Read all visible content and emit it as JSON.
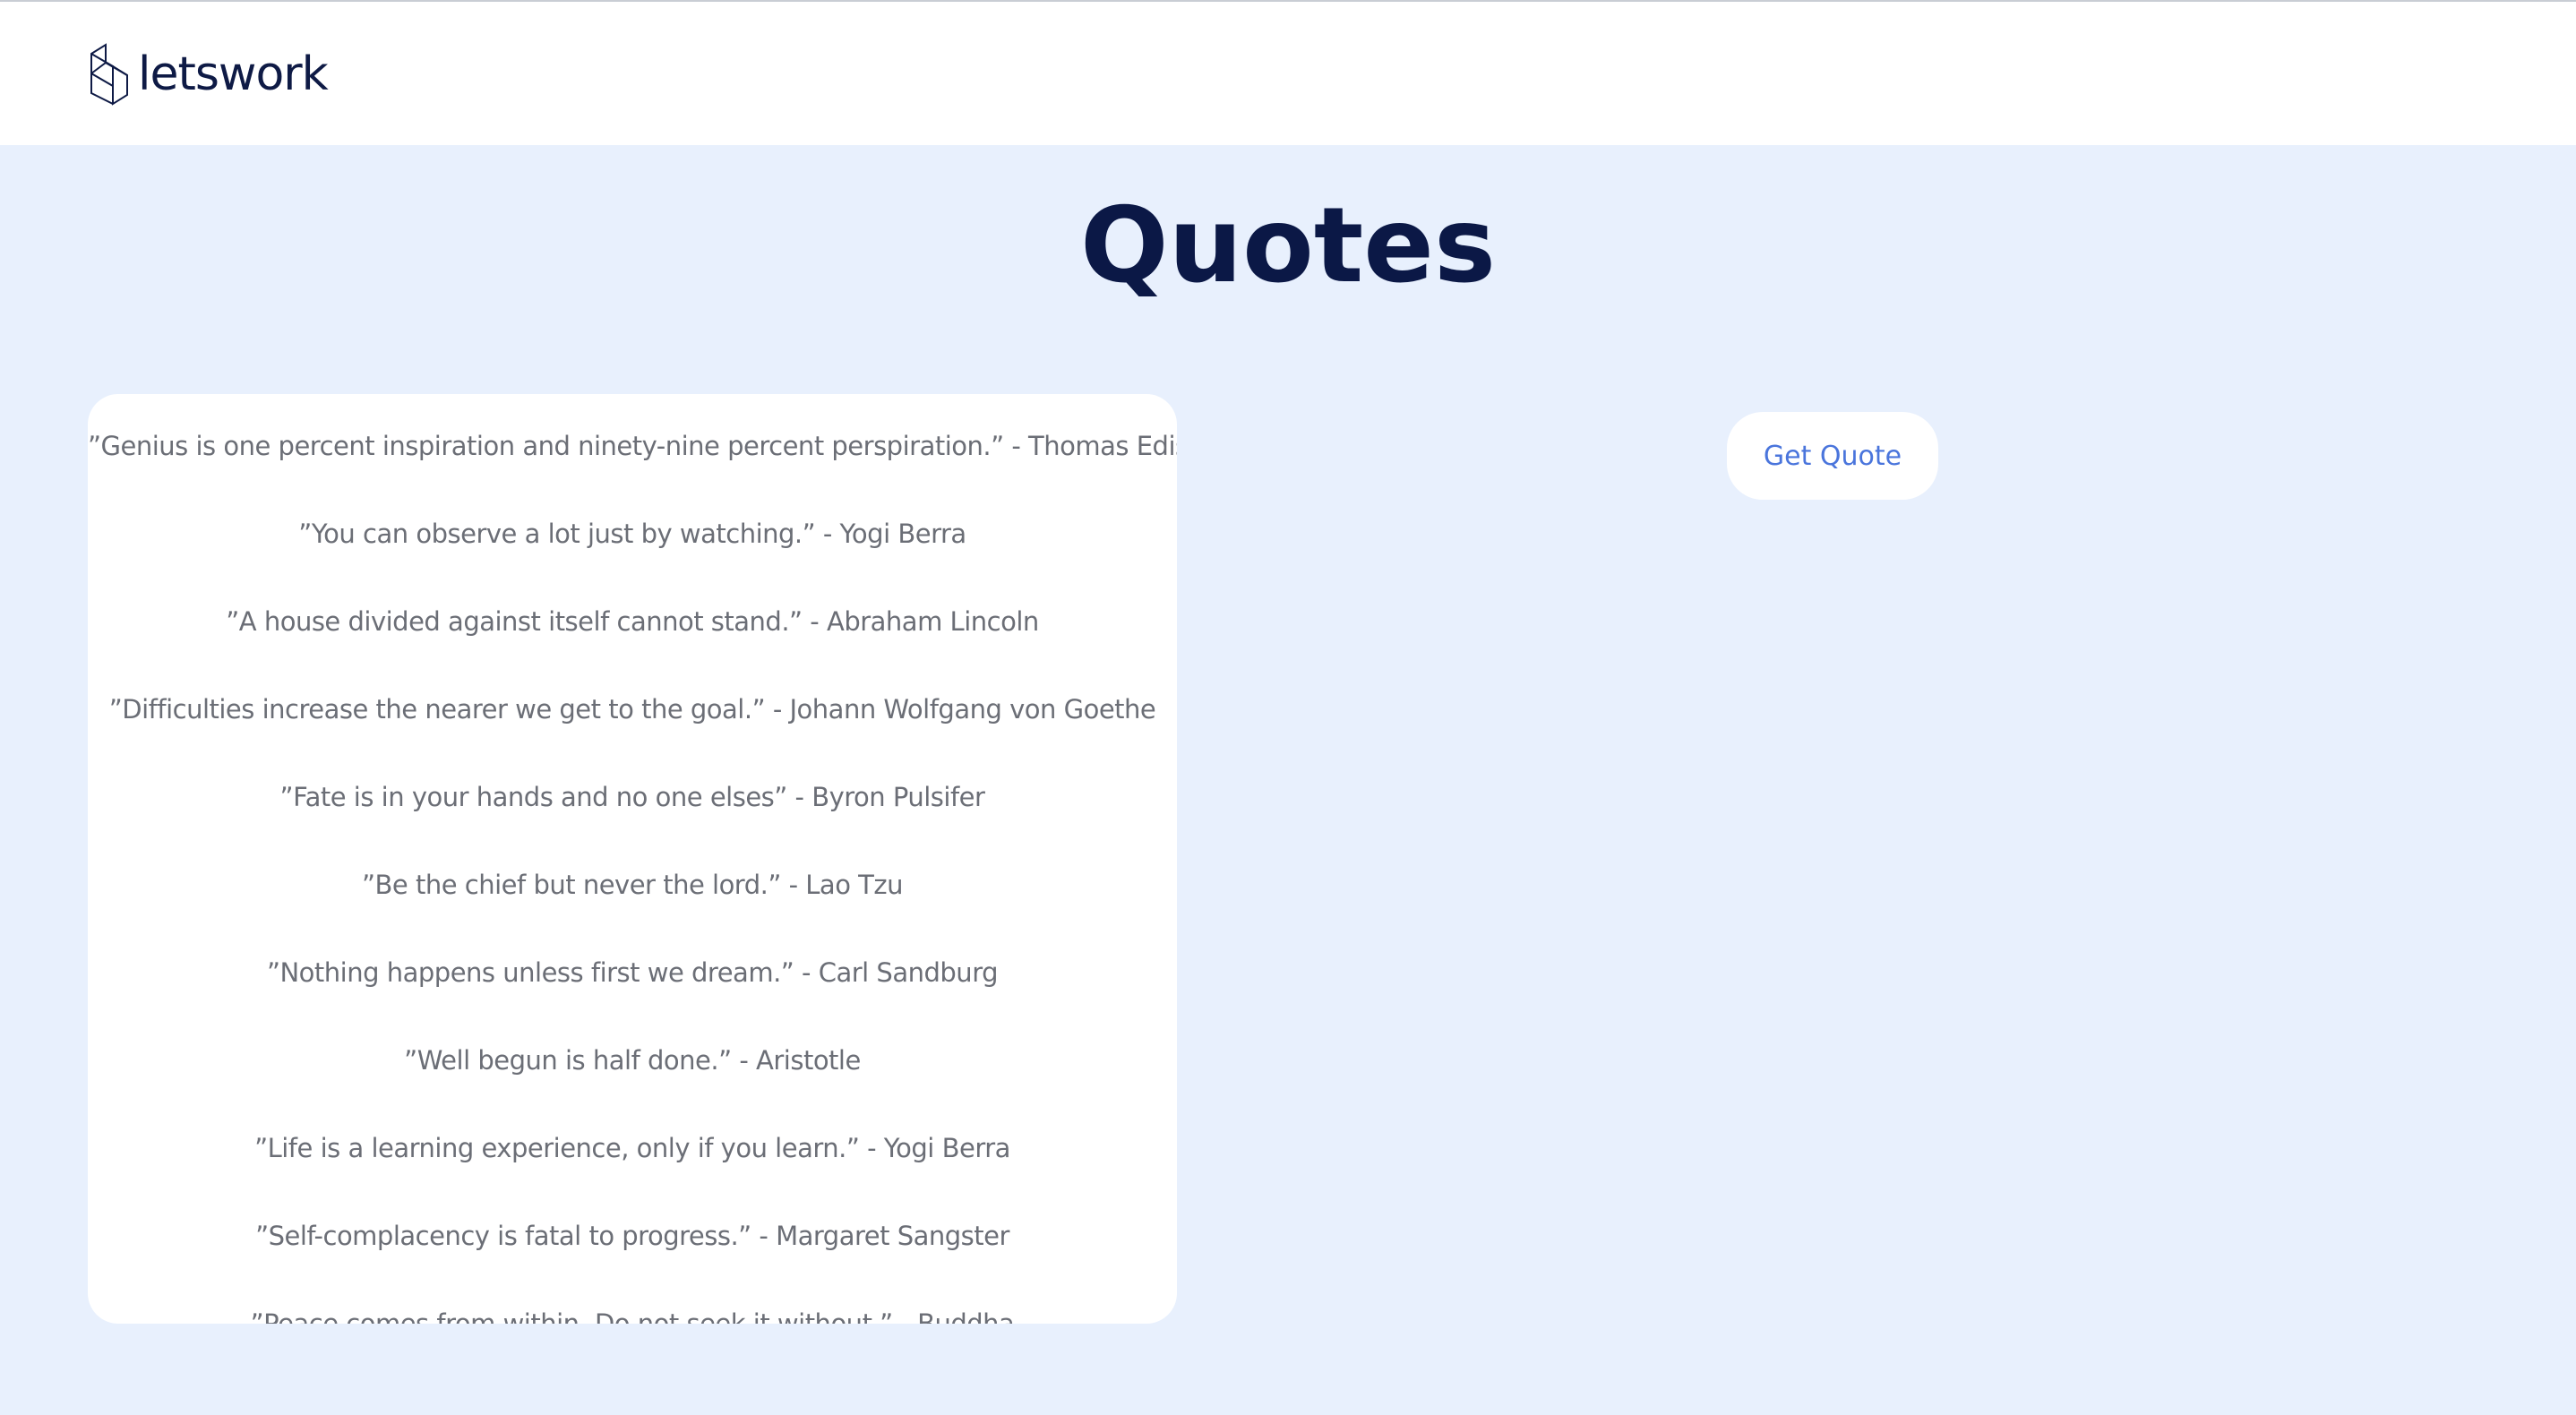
{
  "header": {
    "logo_text": "letswork",
    "logo_icon": "cube-outline-icon"
  },
  "page": {
    "title": "Quotes"
  },
  "quotes": [
    "”Genius is one percent inspiration and ninety-nine percent perspiration.” - Thomas Edison",
    "”You can observe a lot just by watching.” - Yogi Berra",
    "”A house divided against itself cannot stand.” - Abraham Lincoln",
    "”Difficulties increase the nearer we get to the goal.” - Johann Wolfgang von Goethe",
    "”Fate is in your hands and no one elses” - Byron Pulsifer",
    "”Be the chief but never the lord.” - Lao Tzu",
    "”Nothing happens unless first we dream.” - Carl Sandburg",
    "”Well begun is half done.” - Aristotle",
    "”Life is a learning experience, only if you learn.” - Yogi Berra",
    "”Self-complacency is fatal to progress.” - Margaret Sangster",
    "”Peace comes from within. Do not seek it without.” - Buddha"
  ],
  "actions": {
    "get_quote_label": "Get Quote"
  },
  "colors": {
    "background": "#e8f0fd",
    "title": "#0b1846",
    "quote_text": "#6b6e76",
    "button_text": "#4a75dc"
  }
}
